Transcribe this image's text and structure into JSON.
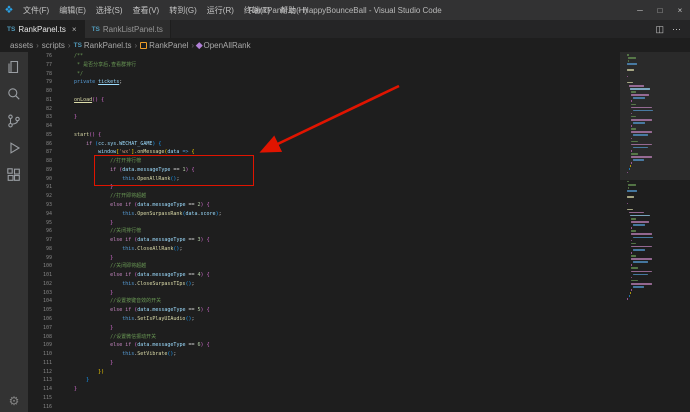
{
  "titlebar": {
    "title": "RankPanel.ts - HappyBounceBall - Visual Studio Code",
    "menus": [
      {
        "label": "文件(F)"
      },
      {
        "label": "编辑(E)"
      },
      {
        "label": "选择(S)"
      },
      {
        "label": "查看(V)"
      },
      {
        "label": "转到(G)"
      },
      {
        "label": "运行(R)"
      },
      {
        "label": "终端(T)"
      },
      {
        "label": "帮助(H)"
      }
    ]
  },
  "icons": {
    "logo": "❖",
    "close": "×",
    "more": "⋯",
    "split": "◫",
    "minimize": "─",
    "maximize": "□",
    "close_window": "×",
    "gear": "⚙"
  },
  "tabs": [
    {
      "icon": "TS",
      "label": "RankPanel.ts",
      "active": true
    },
    {
      "icon": "TS",
      "label": "RankListPanel.ts",
      "active": false
    }
  ],
  "breadcrumbs": {
    "separator": "›",
    "items": [
      {
        "label": "assets"
      },
      {
        "label": "scripts"
      },
      {
        "label": "RankPanel.ts",
        "icon": "TS"
      },
      {
        "label": "RankPanel"
      },
      {
        "label": "OpenAllRank"
      }
    ]
  },
  "colors": {
    "annotation_red": "#e01400",
    "ts_icon_blue": "#519aba"
  },
  "editor": {
    "first_line": 76,
    "last_line": 116,
    "lines": [
      {
        "n": 76,
        "t": [
          [
            "c",
            "    /**"
          ]
        ]
      },
      {
        "n": 77,
        "t": [
          [
            "c",
            "     * 是否分享后,查看群排行"
          ]
        ]
      },
      {
        "n": 78,
        "t": [
          [
            "c",
            "     */"
          ]
        ]
      },
      {
        "n": 79,
        "t": [
          [
            "p",
            "    "
          ],
          [
            "k",
            "private"
          ],
          [
            "p",
            " "
          ],
          [
            "vu",
            "tickets"
          ],
          [
            "p",
            ";"
          ]
        ]
      },
      {
        "n": 80,
        "t": []
      },
      {
        "n": 81,
        "t": [
          [
            "p",
            "    "
          ],
          [
            "fnu",
            "onLoad"
          ],
          [
            "bp",
            "()"
          ],
          [
            "p",
            " "
          ],
          [
            "bp",
            "{"
          ]
        ]
      },
      {
        "n": 82,
        "t": []
      },
      {
        "n": 83,
        "t": [
          [
            "p",
            "    "
          ],
          [
            "bp",
            "}"
          ]
        ]
      },
      {
        "n": 84,
        "t": []
      },
      {
        "n": 85,
        "t": [
          [
            "p",
            "    "
          ],
          [
            "fn",
            "start"
          ],
          [
            "bp",
            "()"
          ],
          [
            "p",
            " "
          ],
          [
            "bp",
            "{"
          ]
        ]
      },
      {
        "n": 86,
        "t": [
          [
            "p",
            "        "
          ],
          [
            "cf",
            "if"
          ],
          [
            "p",
            " "
          ],
          [
            "bb",
            "("
          ],
          [
            "v",
            "cc"
          ],
          [
            "p",
            "."
          ],
          [
            "v",
            "sys"
          ],
          [
            "p",
            "."
          ],
          [
            "v",
            "WECHAT_GAME"
          ],
          [
            "bb",
            ")"
          ],
          [
            "p",
            " "
          ],
          [
            "bb",
            "{"
          ]
        ]
      },
      {
        "n": 87,
        "t": [
          [
            "p",
            "            "
          ],
          [
            "v",
            "window"
          ],
          [
            "bg",
            "["
          ],
          [
            "s",
            "'wx'"
          ],
          [
            "bg",
            "]"
          ],
          [
            "p",
            "."
          ],
          [
            "fn",
            "onMessage"
          ],
          [
            "bg",
            "("
          ],
          [
            "v",
            "data"
          ],
          [
            "p",
            " "
          ],
          [
            "k",
            "=>"
          ],
          [
            "p",
            " "
          ],
          [
            "bg",
            "{"
          ]
        ]
      },
      {
        "n": 88,
        "t": [
          [
            "c",
            "                //打开排行榜"
          ]
        ]
      },
      {
        "n": 89,
        "t": [
          [
            "p",
            "                "
          ],
          [
            "cf",
            "if"
          ],
          [
            "p",
            " "
          ],
          [
            "bp",
            "("
          ],
          [
            "v",
            "data"
          ],
          [
            "p",
            "."
          ],
          [
            "v",
            "messageType"
          ],
          [
            "p",
            " == "
          ],
          [
            "n",
            "1"
          ],
          [
            "bp",
            ")"
          ],
          [
            "p",
            " "
          ],
          [
            "bp",
            "{"
          ]
        ]
      },
      {
        "n": 90,
        "t": [
          [
            "p",
            "                    "
          ],
          [
            "k",
            "this"
          ],
          [
            "p",
            "."
          ],
          [
            "fn",
            "OpenAllRank"
          ],
          [
            "bb",
            "()"
          ],
          [
            "p",
            ";"
          ]
        ]
      },
      {
        "n": 91,
        "t": [
          [
            "p",
            "                "
          ],
          [
            "bp",
            "}"
          ]
        ]
      },
      {
        "n": 92,
        "t": [
          [
            "c",
            "                //打开即将超越"
          ]
        ]
      },
      {
        "n": 93,
        "t": [
          [
            "p",
            "                "
          ],
          [
            "cf",
            "else"
          ],
          [
            "p",
            " "
          ],
          [
            "cf",
            "if"
          ],
          [
            "p",
            " "
          ],
          [
            "bp",
            "("
          ],
          [
            "v",
            "data"
          ],
          [
            "p",
            "."
          ],
          [
            "v",
            "messageType"
          ],
          [
            "p",
            " == "
          ],
          [
            "n",
            "2"
          ],
          [
            "bp",
            ")"
          ],
          [
            "p",
            " "
          ],
          [
            "bp",
            "{"
          ]
        ]
      },
      {
        "n": 94,
        "t": [
          [
            "p",
            "                    "
          ],
          [
            "k",
            "this"
          ],
          [
            "p",
            "."
          ],
          [
            "fn",
            "OpenSurpassRank"
          ],
          [
            "bb",
            "("
          ],
          [
            "v",
            "data"
          ],
          [
            "p",
            "."
          ],
          [
            "v",
            "score"
          ],
          [
            "bb",
            ")"
          ],
          [
            "p",
            ";"
          ]
        ]
      },
      {
        "n": 95,
        "t": [
          [
            "p",
            "                "
          ],
          [
            "bp",
            "}"
          ]
        ]
      },
      {
        "n": 96,
        "t": [
          [
            "c",
            "                //关闭排行榜"
          ]
        ]
      },
      {
        "n": 97,
        "t": [
          [
            "p",
            "                "
          ],
          [
            "cf",
            "else"
          ],
          [
            "p",
            " "
          ],
          [
            "cf",
            "if"
          ],
          [
            "p",
            " "
          ],
          [
            "bp",
            "("
          ],
          [
            "v",
            "data"
          ],
          [
            "p",
            "."
          ],
          [
            "v",
            "messageType"
          ],
          [
            "p",
            " == "
          ],
          [
            "n",
            "3"
          ],
          [
            "bp",
            ")"
          ],
          [
            "p",
            " "
          ],
          [
            "bp",
            "{"
          ]
        ]
      },
      {
        "n": 98,
        "t": [
          [
            "p",
            "                    "
          ],
          [
            "k",
            "this"
          ],
          [
            "p",
            "."
          ],
          [
            "fn",
            "CloseAllRank"
          ],
          [
            "bb",
            "()"
          ],
          [
            "p",
            ";"
          ]
        ]
      },
      {
        "n": 99,
        "t": [
          [
            "p",
            "                "
          ],
          [
            "bp",
            "}"
          ]
        ]
      },
      {
        "n": 100,
        "t": [
          [
            "c",
            "                //关闭即将超越"
          ]
        ]
      },
      {
        "n": 101,
        "t": [
          [
            "p",
            "                "
          ],
          [
            "cf",
            "else"
          ],
          [
            "p",
            " "
          ],
          [
            "cf",
            "if"
          ],
          [
            "p",
            " "
          ],
          [
            "bp",
            "("
          ],
          [
            "v",
            "data"
          ],
          [
            "p",
            "."
          ],
          [
            "v",
            "messageType"
          ],
          [
            "p",
            " == "
          ],
          [
            "n",
            "4"
          ],
          [
            "bp",
            ")"
          ],
          [
            "p",
            " "
          ],
          [
            "bp",
            "{"
          ]
        ]
      },
      {
        "n": 102,
        "t": [
          [
            "p",
            "                    "
          ],
          [
            "k",
            "this"
          ],
          [
            "p",
            "."
          ],
          [
            "fn",
            "CloseSurpassTIps"
          ],
          [
            "bb",
            "()"
          ],
          [
            "p",
            ";"
          ]
        ]
      },
      {
        "n": 103,
        "t": [
          [
            "p",
            "                "
          ],
          [
            "bp",
            "}"
          ]
        ]
      },
      {
        "n": 104,
        "t": [
          [
            "c",
            "                //设置按键音效的开关"
          ]
        ]
      },
      {
        "n": 105,
        "t": [
          [
            "p",
            "                "
          ],
          [
            "cf",
            "else"
          ],
          [
            "p",
            " "
          ],
          [
            "cf",
            "if"
          ],
          [
            "p",
            " "
          ],
          [
            "bp",
            "("
          ],
          [
            "v",
            "data"
          ],
          [
            "p",
            "."
          ],
          [
            "v",
            "messageType"
          ],
          [
            "p",
            " == "
          ],
          [
            "n",
            "5"
          ],
          [
            "bp",
            ")"
          ],
          [
            "p",
            " "
          ],
          [
            "bp",
            "{"
          ]
        ]
      },
      {
        "n": 106,
        "t": [
          [
            "p",
            "                    "
          ],
          [
            "k",
            "this"
          ],
          [
            "p",
            "."
          ],
          [
            "fn",
            "SetIsPlayUIAudio"
          ],
          [
            "bb",
            "()"
          ],
          [
            "p",
            ";"
          ]
        ]
      },
      {
        "n": 107,
        "t": [
          [
            "p",
            "                "
          ],
          [
            "bp",
            "}"
          ]
        ]
      },
      {
        "n": 108,
        "t": [
          [
            "c",
            "                //设置微信振动开关"
          ]
        ]
      },
      {
        "n": 109,
        "t": [
          [
            "p",
            "                "
          ],
          [
            "cf",
            "else"
          ],
          [
            "p",
            " "
          ],
          [
            "cf",
            "if"
          ],
          [
            "p",
            " "
          ],
          [
            "bp",
            "("
          ],
          [
            "v",
            "data"
          ],
          [
            "p",
            "."
          ],
          [
            "v",
            "messageType"
          ],
          [
            "p",
            " == "
          ],
          [
            "n",
            "6"
          ],
          [
            "bp",
            ")"
          ],
          [
            "p",
            " "
          ],
          [
            "bp",
            "{"
          ]
        ]
      },
      {
        "n": 110,
        "t": [
          [
            "p",
            "                    "
          ],
          [
            "k",
            "this"
          ],
          [
            "p",
            "."
          ],
          [
            "fn",
            "SetVibrate"
          ],
          [
            "bb",
            "()"
          ],
          [
            "p",
            ";"
          ]
        ]
      },
      {
        "n": 111,
        "t": [
          [
            "p",
            "                "
          ],
          [
            "bp",
            "}"
          ]
        ]
      },
      {
        "n": 112,
        "t": [
          [
            "p",
            "            "
          ],
          [
            "bg",
            "})"
          ]
        ]
      },
      {
        "n": 113,
        "t": [
          [
            "p",
            "        "
          ],
          [
            "bb",
            "}"
          ]
        ]
      },
      {
        "n": 114,
        "t": [
          [
            "p",
            "    "
          ],
          [
            "bp",
            "}"
          ]
        ]
      },
      {
        "n": 115,
        "t": []
      },
      {
        "n": 116,
        "t": []
      }
    ]
  }
}
